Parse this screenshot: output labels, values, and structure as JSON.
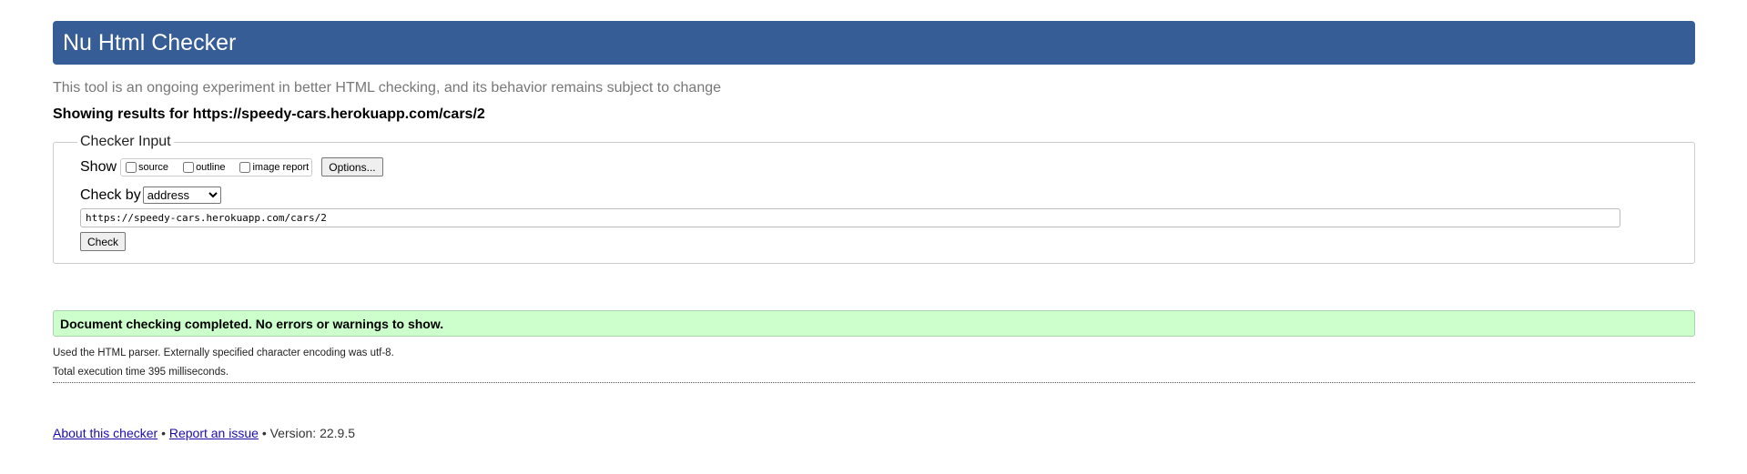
{
  "header": {
    "title": "Nu Html Checker"
  },
  "tagline": "This tool is an ongoing experiment in better HTML checking, and its behavior remains subject to change",
  "showing_results": "Showing results for https://speedy-cars.herokuapp.com/cars/2",
  "checker_input": {
    "legend": "Checker Input",
    "show_label": "Show",
    "show_options": [
      {
        "label": "source",
        "checked": false
      },
      {
        "label": "outline",
        "checked": false
      },
      {
        "label": "image report",
        "checked": false
      }
    ],
    "options_button": "Options...",
    "check_by_label": "Check by",
    "check_by_selected": "address",
    "url_value": "https://speedy-cars.herokuapp.com/cars/2",
    "check_button": "Check"
  },
  "result": {
    "message": "Document checking completed. No errors or warnings to show.",
    "parser_info": "Used the HTML parser. Externally specified character encoding was utf-8.",
    "execution_time": "Total execution time 395 milliseconds."
  },
  "footer": {
    "about_link": "About this checker",
    "separator": "•",
    "report_link": "Report an issue",
    "version": "• Version: 22.9.5"
  },
  "colors": {
    "header_bg": "#365d95",
    "success_bg": "#ccffcc",
    "link": "#1a0dab"
  }
}
